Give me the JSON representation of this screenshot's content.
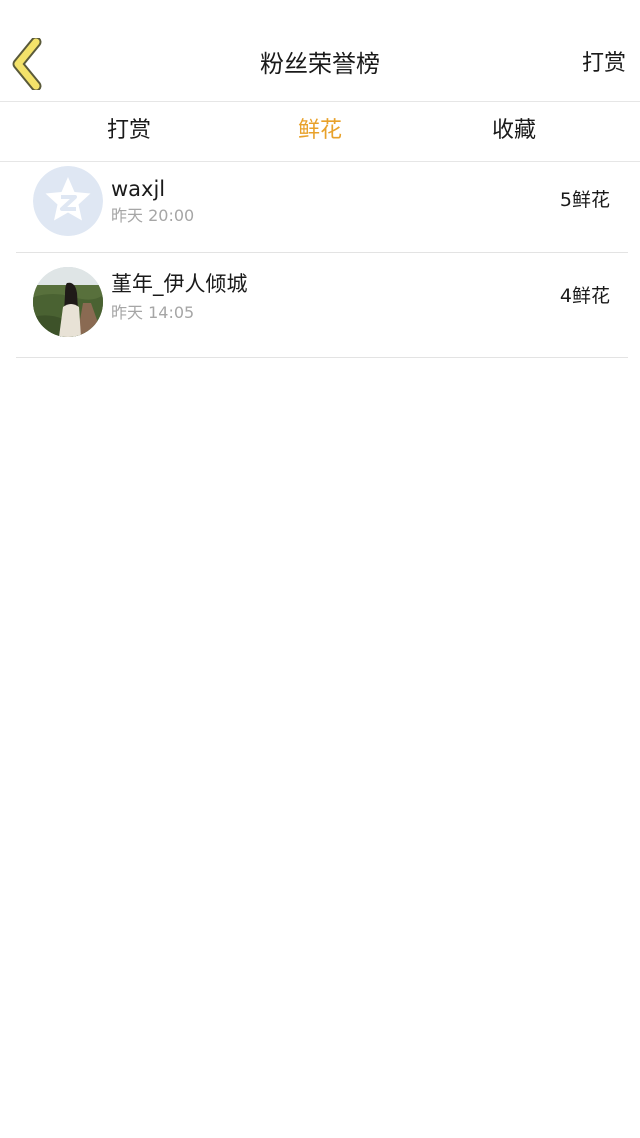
{
  "nav": {
    "title": "粉丝荣誉榜",
    "action_label": "打赏",
    "back_icon": "chevron-left-icon"
  },
  "tabs": [
    {
      "label": "打赏",
      "active": false
    },
    {
      "label": "鲜花",
      "active": true
    },
    {
      "label": "收藏",
      "active": false
    }
  ],
  "colors": {
    "active_tab": "#e8a12a",
    "back_icon_fill": "#f3e26a",
    "back_icon_stroke": "#5a5a3a",
    "secondary_text": "#a6a6a6",
    "divider": "#e3e3e3"
  },
  "fans": [
    {
      "name": "waxjl",
      "time": "昨天 20:00",
      "gift": "5鲜花",
      "avatar": "qzone-default-avatar-icon"
    },
    {
      "name": "堇年_伊人倾城",
      "time": "昨天 14:05",
      "gift": "4鲜花",
      "avatar": "photo-avatar"
    }
  ]
}
